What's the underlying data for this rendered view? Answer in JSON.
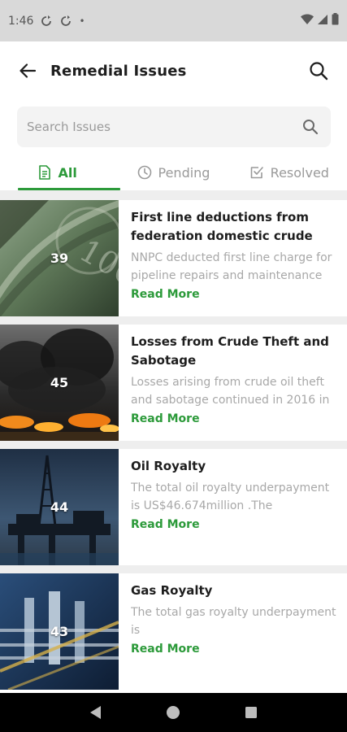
{
  "status_bar": {
    "time": "1:46",
    "dot": "•",
    "left_icons": [
      "sync-icon",
      "sync-icon"
    ],
    "right_icons": [
      "wifi-icon",
      "signal-icon",
      "battery-icon"
    ]
  },
  "header": {
    "title": "Remedial Issues",
    "back_icon": "arrow-left-icon",
    "search_icon": "search-icon"
  },
  "search": {
    "placeholder": "Search Issues",
    "value": ""
  },
  "tabs": [
    {
      "label": "All",
      "icon": "document-icon",
      "active": true
    },
    {
      "label": "Pending",
      "icon": "clock-icon",
      "active": false
    },
    {
      "label": "Resolved",
      "icon": "checkbox-icon",
      "active": false
    }
  ],
  "issues": [
    {
      "count": "39",
      "title": "First line deductions from federation domestic crude",
      "desc": "NNPC deducted first line charge for pipeline repairs and maintenance",
      "read_more": "Read More",
      "image": "money-image"
    },
    {
      "count": "45",
      "title": "Losses from Crude Theft and Sabotage",
      "desc": "Losses arising from crude oil theft and sabotage continued in 2016 in",
      "read_more": "Read More",
      "image": "fire-smoke-image"
    },
    {
      "count": "44",
      "title": "Oil Royalty",
      "desc": "The total oil royalty underpayment is US$46.674million .The",
      "read_more": "Read More",
      "image": "oil-rig-image"
    },
    {
      "count": "43",
      "title": "Gas Royalty",
      "desc": "The total gas royalty underpayment is",
      "read_more": "Read More",
      "image": "gas-plant-image"
    }
  ],
  "colors": {
    "accent": "#2c9a3a",
    "muted": "#9a9a9a"
  }
}
